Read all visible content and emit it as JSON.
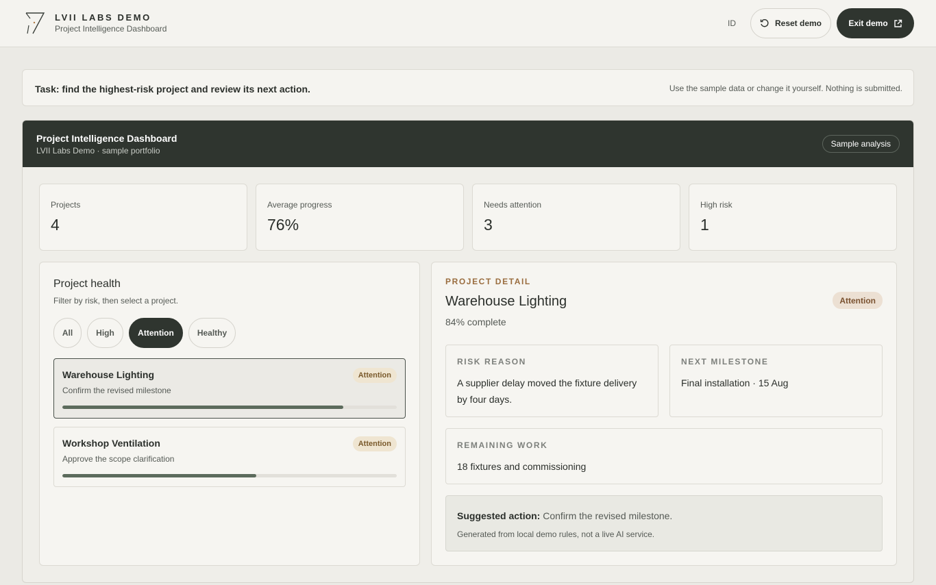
{
  "header": {
    "brand_title": "LVII LABS DEMO",
    "brand_subtitle": "Project Intelligence Dashboard",
    "language": "ID",
    "reset_label": "Reset demo",
    "exit_label": "Exit demo"
  },
  "task": {
    "text": "Task: find the highest-risk project and review its next action.",
    "note": "Use the sample data or change it yourself. Nothing is submitted."
  },
  "dashboard": {
    "title": "Project Intelligence Dashboard",
    "subtitle": "LVII Labs Demo · sample portfolio",
    "sample_label": "Sample analysis"
  },
  "stats": [
    {
      "label": "Projects",
      "value": "4"
    },
    {
      "label": "Average progress",
      "value": "76%"
    },
    {
      "label": "Needs attention",
      "value": "3"
    },
    {
      "label": "High risk",
      "value": "1"
    }
  ],
  "health": {
    "title": "Project health",
    "subtitle": "Filter by risk, then select a project.",
    "filters": [
      "All",
      "High",
      "Attention",
      "Healthy"
    ],
    "active_filter": "Attention",
    "projects": [
      {
        "name": "Warehouse Lighting",
        "action": "Confirm the revised milestone",
        "status": "Attention",
        "progress": 0.84,
        "selected": true
      },
      {
        "name": "Workshop Ventilation",
        "action": "Approve the scope clarification",
        "status": "Attention",
        "progress": 0.58,
        "selected": false
      }
    ]
  },
  "detail": {
    "kicker": "PROJECT DETAIL",
    "name": "Warehouse Lighting",
    "complete": "84% complete",
    "status": "Attention",
    "risk_label": "RISK REASON",
    "risk_text": "A supplier delay moved the fixture delivery by four days.",
    "milestone_label": "NEXT MILESTONE",
    "milestone_text": "Final installation · 15 Aug",
    "remaining_label": "REMAINING WORK",
    "remaining_text": "18 fixtures and commissioning",
    "suggest_label": "Suggested action:",
    "suggest_text": "Confirm the revised milestone.",
    "suggest_note": "Generated from local demo rules, not a live AI service."
  },
  "colors": {
    "accent_dark": "#2f352f",
    "progress_fill": "#5c6b5c",
    "attention_badge": "#efe5d1",
    "kicker": "#9a6d3f"
  }
}
